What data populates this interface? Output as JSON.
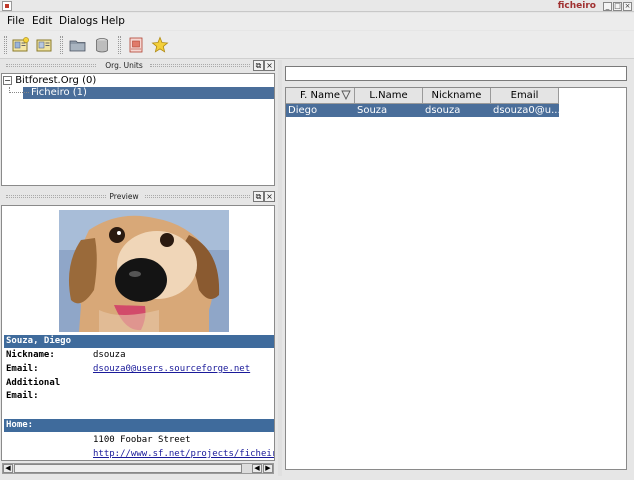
{
  "window": {
    "title": "ficheiro"
  },
  "menu": {
    "file": "File",
    "edit": "Edit",
    "dialogs": "Dialogs",
    "help": "Help"
  },
  "toolbar": {
    "icons": [
      "new-card-icon",
      "open-card-icon",
      "folder-icon",
      "database-icon",
      "address-book-icon",
      "star-icon"
    ]
  },
  "org_units": {
    "title": "Org. Units",
    "items": [
      {
        "label": "Bitforest.Org (0)"
      },
      {
        "label": "Ficheiro (1)"
      }
    ]
  },
  "preview": {
    "title": "Preview",
    "name_header": "Souza, Diego",
    "fields": {
      "nickname_label": "Nickname:",
      "nickname_value": "dsouza",
      "email_label": "Email:",
      "email_value": "dsouza0@users.sourceforge.net",
      "additional_email_label_1": "Additional",
      "additional_email_label_2": "Email:"
    },
    "home_header": "Home:",
    "home_street": "1100 Foobar Street",
    "home_url": "http://www.sf.net/projects/ficheiro"
  },
  "search": {
    "value": ""
  },
  "table": {
    "columns": [
      "F. Name",
      "L.Name",
      "Nickname",
      "Email"
    ],
    "rows": [
      {
        "first": "Diego",
        "last": "Souza",
        "nickname": "dsouza",
        "email": "dsouza0@u..."
      }
    ]
  },
  "colors": {
    "selection": "#4a6e9a",
    "preview_header": "#3f6b9c",
    "title_accent": "#a03030"
  }
}
